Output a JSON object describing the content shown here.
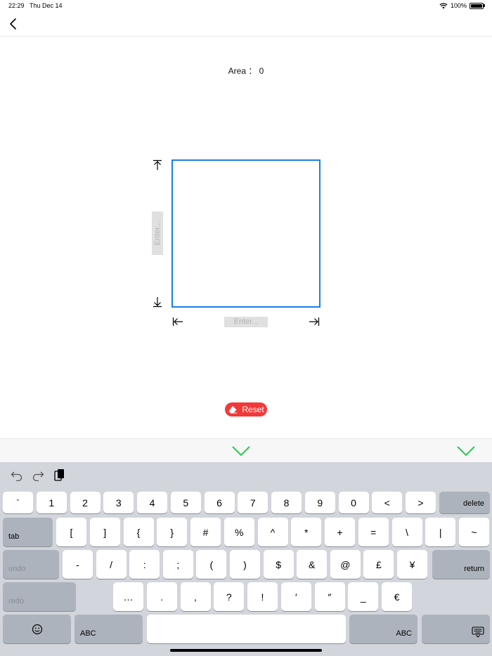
{
  "status_bar": {
    "time": "22:29",
    "date": "Thu Dec 14",
    "battery": "100%"
  },
  "canvas": {
    "area_label": "Area ： 0",
    "height_placeholder": "Enter...",
    "width_placeholder": "Enter...",
    "shape_color": "#1a7fe6"
  },
  "reset_button": {
    "label": "Reset",
    "color": "#f2393a"
  },
  "accessory_bar": {
    "done_color": "#2cc84f"
  },
  "keyboard": {
    "row1": [
      "`",
      "1",
      "2",
      "3",
      "4",
      "5",
      "6",
      "7",
      "8",
      "9",
      "0",
      "<",
      ">"
    ],
    "delete": "delete",
    "tab": "tab",
    "row2": [
      "[",
      "]",
      "{",
      "}",
      "#",
      "%",
      "^",
      "*",
      "+",
      "=",
      "\\",
      "|",
      "~"
    ],
    "undo": "undo",
    "row3": [
      "-",
      "/",
      ":",
      ";",
      "(",
      ")",
      "$",
      "&",
      "@",
      "£",
      "¥"
    ],
    "return": "return",
    "redo": "redo",
    "row4": [
      "…",
      ".",
      ",",
      "?",
      "!",
      "′",
      "″",
      "_",
      "€"
    ],
    "abc_left": "ABC",
    "abc_right": "ABC"
  }
}
